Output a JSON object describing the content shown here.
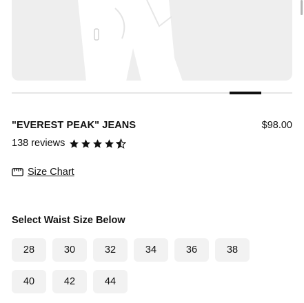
{
  "product": {
    "title": "\"EVEREST PEAK\" JEANS",
    "price": "$98.00",
    "reviews_label": "138 reviews",
    "rating": 4.5,
    "rating_max": 5
  },
  "gallery": {
    "active_index": 6
  },
  "size_chart": {
    "label": "Size Chart",
    "icon": "ruler-icon"
  },
  "size_selector": {
    "heading": "Select Waist Size Below",
    "rows": [
      [
        "28",
        "30",
        "32",
        "34",
        "36",
        "38"
      ],
      [
        "40",
        "42",
        "44"
      ]
    ]
  },
  "colors": {
    "image_bg": "#eeeeee",
    "button_bg": "#f2f2f2",
    "text": "#111111"
  }
}
